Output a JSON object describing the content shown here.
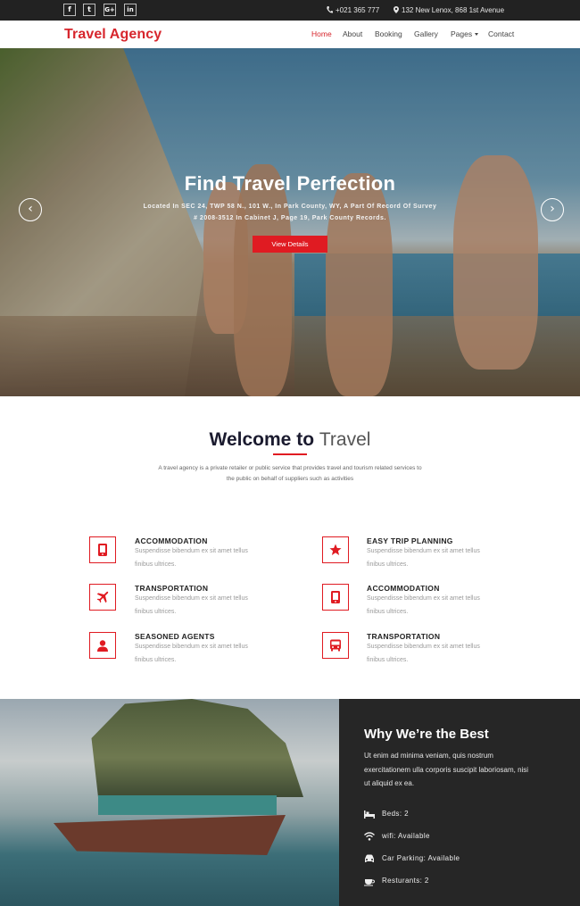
{
  "topbar": {
    "social": [
      {
        "name": "facebook",
        "glyph": "f"
      },
      {
        "name": "twitter",
        "glyph": "t"
      },
      {
        "name": "google-plus",
        "glyph": "G+"
      },
      {
        "name": "linkedin",
        "glyph": "in"
      }
    ],
    "phone": "+021 365 777",
    "address": "132 New Lenox, 868 1st Avenue"
  },
  "header": {
    "logo": "Travel Agency",
    "nav": [
      {
        "label": "Home",
        "active": true
      },
      {
        "label": "About",
        "active": false
      },
      {
        "label": "Booking",
        "active": false
      },
      {
        "label": "Gallery",
        "active": false
      },
      {
        "label": "Pages",
        "active": false,
        "dropdown": true
      },
      {
        "label": "Contact",
        "active": false
      }
    ]
  },
  "hero": {
    "title": "Find Travel Perfection",
    "subtitle": "Located In SEC 24, TWP 58 N., 101 W., In Park County, WY, A Part Of Record Of Survey # 2008-3512 In Cabinet J, Page 19, Park County Records.",
    "button": "View Details",
    "prev_glyph": "‹",
    "next_glyph": "›"
  },
  "welcome": {
    "title_bold": "Welcome to",
    "title_light": "Travel",
    "text": "A travel agency is a private retailer or public service that provides travel and tourism related services to the public on behalf of suppliers such as activities"
  },
  "features": [
    {
      "title": "ACCOMMODATION",
      "desc": "Suspendisse bibendum ex sit amet tellus finibus ultrices.",
      "icon": "mobile-icon"
    },
    {
      "title": "EASY TRIP PLANNING",
      "desc": "Suspendisse bibendum ex sit amet tellus finibus ultrices.",
      "icon": "star-icon"
    },
    {
      "title": "TRANSPORTATION",
      "desc": "Suspendisse bibendum ex sit amet tellus finibus ultrices.",
      "icon": "plane-icon"
    },
    {
      "title": "ACCOMMODATION",
      "desc": "Suspendisse bibendum ex sit amet tellus finibus ultrices.",
      "icon": "mobile-icon"
    },
    {
      "title": "SEASONED AGENTS",
      "desc": "Suspendisse bibendum ex sit amet tellus finibus ultrices.",
      "icon": "user-icon"
    },
    {
      "title": "TRANSPORTATION",
      "desc": "Suspendisse bibendum ex sit amet tellus finibus ultrices.",
      "icon": "bus-icon"
    }
  ],
  "why": {
    "title": "Why We’re the Best",
    "text": "Ut enim ad minima veniam, quis nostrum exercitationem ulla corporis suscipit laboriosam, nisi ut aliquid ex ea.",
    "amenities": [
      {
        "label": "Beds: 2",
        "icon": "bed-icon"
      },
      {
        "label": "wifi: Available",
        "icon": "wifi-icon"
      },
      {
        "label": "Car Parking: Available",
        "icon": "car-icon"
      },
      {
        "label": "Resturants: 2",
        "icon": "restaurant-icon"
      }
    ]
  },
  "colors": {
    "accent": "#e01b22",
    "topbar": "#222222",
    "dark_panel": "#262626"
  }
}
